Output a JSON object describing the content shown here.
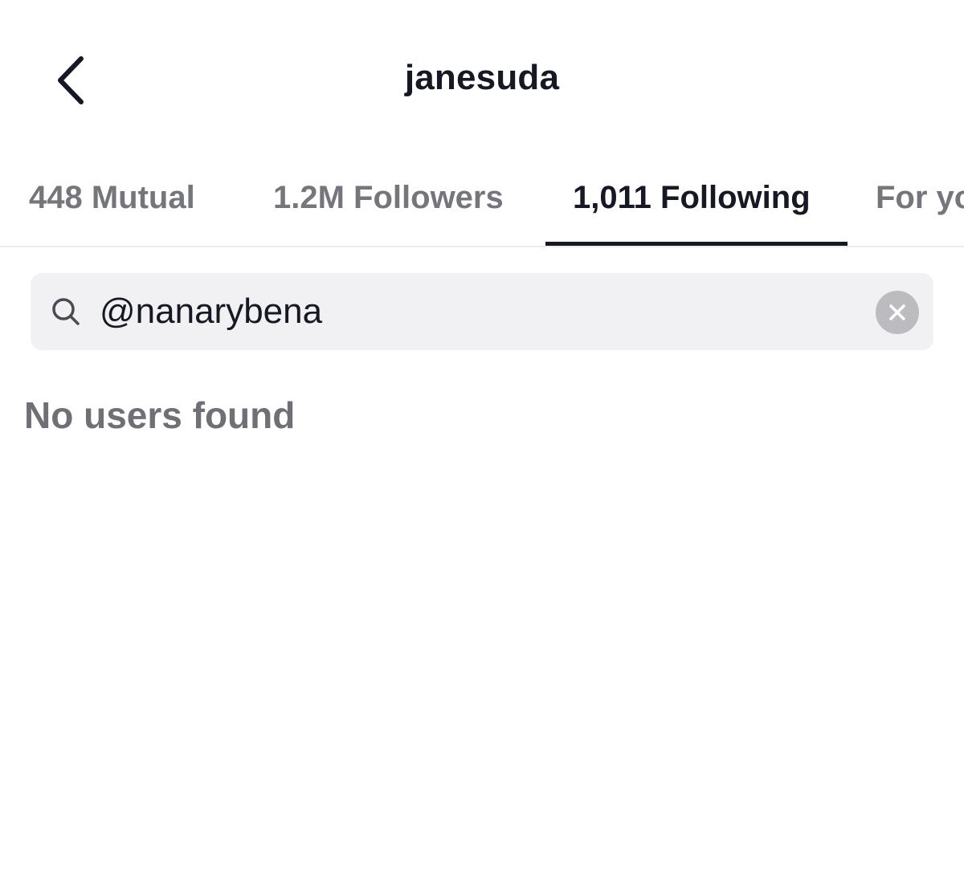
{
  "header": {
    "title": "janesuda",
    "back_icon": "chevron-left-icon"
  },
  "tabs": [
    {
      "label": "448 Mutual",
      "active": false
    },
    {
      "label": "1.2M Followers",
      "active": false
    },
    {
      "label": "1,011 Following",
      "active": true
    },
    {
      "label": "For you",
      "active": false
    }
  ],
  "search": {
    "icon": "search-icon",
    "value": "@nanarybena",
    "clear_icon": "close-icon"
  },
  "results": {
    "empty_message": "No users found"
  },
  "colors": {
    "text_primary": "#161823",
    "text_secondary": "#75767c",
    "search_background": "#f1f1f3",
    "clear_button": "#bcbcc0"
  }
}
